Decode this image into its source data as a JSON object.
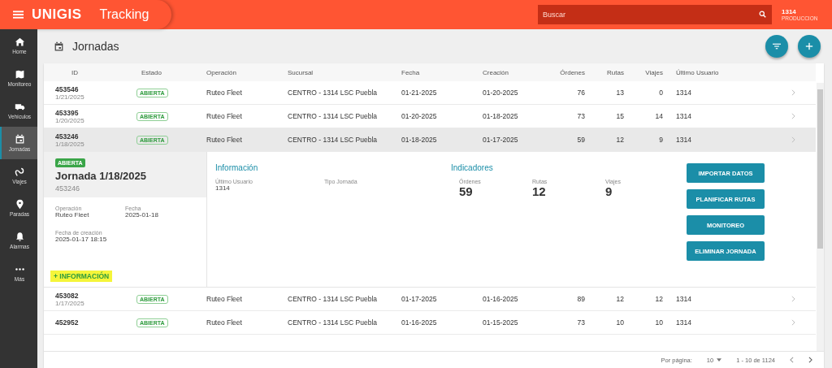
{
  "header": {
    "brand": "UNIGIS",
    "app": "Tracking",
    "search": {
      "placeholder": "Buscar"
    },
    "user": "1314",
    "environment": "PRODUCCION"
  },
  "sidebar": {
    "items": [
      {
        "kind": "home",
        "label": "Home",
        "selected": false
      },
      {
        "kind": "map",
        "label": "Monitoreo",
        "selected": false
      },
      {
        "kind": "truck",
        "label": "Vehículos",
        "selected": false
      },
      {
        "kind": "calendar",
        "label": "Jornadas",
        "selected": true
      },
      {
        "kind": "route",
        "label": "Viajes",
        "selected": false
      },
      {
        "kind": "pin",
        "label": "Paradas",
        "selected": false
      },
      {
        "kind": "bell",
        "label": "Alarmas",
        "selected": false
      },
      {
        "kind": "more",
        "label": "Más",
        "selected": false
      }
    ]
  },
  "page": {
    "title": "Jornadas"
  },
  "table": {
    "columns": [
      "ID",
      "Estado",
      "Operación",
      "Sucursal",
      "Fecha",
      "Creación",
      "Órdenes",
      "Rutas",
      "Viajes",
      "Último Usuario"
    ],
    "rows": [
      {
        "id": "453546",
        "date": "1/21/2025",
        "status": "ABIERTA",
        "operation": "Ruteo Fleet",
        "branch": "CENTRO - 1314 LSC Puebla",
        "fecha": "01-21-2025",
        "creacion": "01-20-2025",
        "ordenes": "76",
        "rutas": "13",
        "viajes": "0",
        "usuario": "1314",
        "selected": false,
        "expanded": false
      },
      {
        "id": "453395",
        "date": "1/20/2025",
        "status": "ABIERTA",
        "operation": "Ruteo Fleet",
        "branch": "CENTRO - 1314 LSC Puebla",
        "fecha": "01-20-2025",
        "creacion": "01-18-2025",
        "ordenes": "73",
        "rutas": "15",
        "viajes": "14",
        "usuario": "1314",
        "selected": false,
        "expanded": false
      },
      {
        "id": "453246",
        "date": "1/18/2025",
        "status": "ABIERTA",
        "operation": "Ruteo Fleet",
        "branch": "CENTRO - 1314 LSC Puebla",
        "fecha": "01-18-2025",
        "creacion": "01-17-2025",
        "ordenes": "59",
        "rutas": "12",
        "viajes": "9",
        "usuario": "1314",
        "selected": true,
        "expanded": true
      },
      {
        "id": "453082",
        "date": "1/17/2025",
        "status": "ABIERTA",
        "operation": "Ruteo Fleet",
        "branch": "CENTRO - 1314 LSC Puebla",
        "fecha": "01-17-2025",
        "creacion": "01-16-2025",
        "ordenes": "89",
        "rutas": "12",
        "viajes": "12",
        "usuario": "1314",
        "selected": false,
        "expanded": false
      },
      {
        "id": "452952",
        "status": "ABIERTA",
        "operation": "Ruteo Fleet",
        "branch": "CENTRO - 1314 LSC Puebla",
        "fecha": "01-16-2025",
        "creacion": "01-15-2025",
        "ordenes": "73",
        "rutas": "10",
        "viajes": "10",
        "usuario": "1314",
        "selected": false,
        "expanded": false
      }
    ]
  },
  "detail": {
    "badge": "ABIERTA",
    "title": "Jornada 1/18/2025",
    "id": "453246",
    "fields": [
      {
        "label": "Operación",
        "value": "Ruteo Fleet"
      },
      {
        "label": "Fecha",
        "value": "2025-01-18"
      },
      {
        "label": "Fecha de creación",
        "value": "2025-01-17 18:15"
      }
    ],
    "more_link": {
      "label": "+ INFORMACIÓN",
      "highlighted": true
    },
    "info": {
      "title": "Información",
      "fields": [
        {
          "label": "Último Usuario",
          "value": "1314"
        },
        {
          "label": "Tipo Jornada"
        }
      ]
    },
    "indicators": {
      "title": "Indicadores",
      "items": [
        {
          "label": "Órdenes",
          "value": "59"
        },
        {
          "label": "Rutas",
          "value": "12"
        },
        {
          "label": "Viajes",
          "value": "9"
        }
      ]
    },
    "buttons": [
      "IMPORTAR DATOS",
      "PLANIFICAR RUTAS",
      "MONITOREO",
      "ELIMINAR JORNADA"
    ]
  },
  "pagination": {
    "per_page_label": "Por página:",
    "per_page": "10",
    "range": "1 - 10 de 1124"
  }
}
